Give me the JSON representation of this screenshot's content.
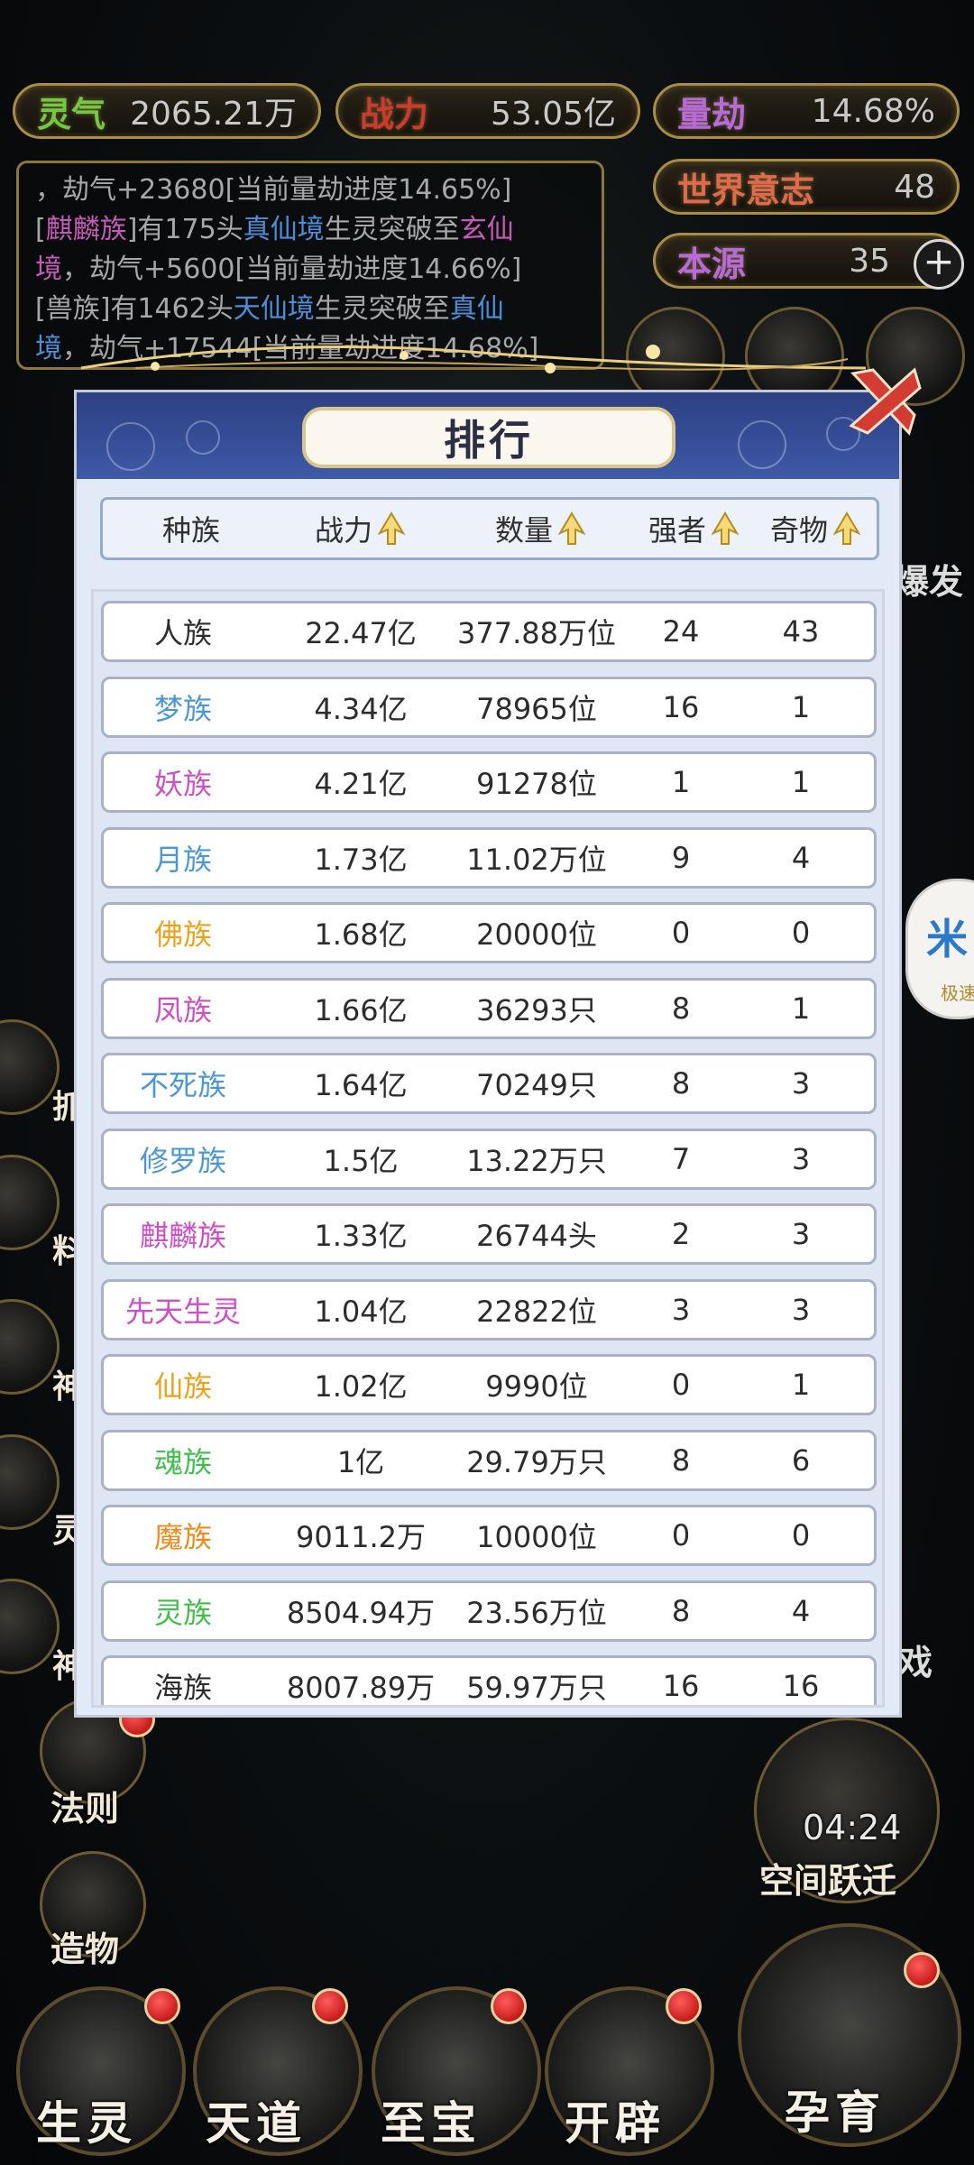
{
  "stats": {
    "lingqi": {
      "label": "灵气",
      "value": "2065.21万",
      "color": "#70c940"
    },
    "zhanli": {
      "label": "战力",
      "value": "53.05亿",
      "color": "#d13a2b"
    },
    "liangjie": {
      "label": "量劫",
      "value": "14.68%",
      "color": "#b86ad8"
    },
    "shijie": {
      "label": "世界意志",
      "value": "48",
      "color": "#e06a4a"
    },
    "benyuan": {
      "label": "本源",
      "value": "35",
      "color": "#b86ad8"
    }
  },
  "log": {
    "line1": "，劫气+23680[当前量劫进度14.65%]",
    "l2_a": "[",
    "l2_race": "麒麟族",
    "l2_b": "]有175头",
    "l2_realm": "真仙境",
    "l2_c": "生灵突破至",
    "l2_realm2": "玄仙",
    "l3_realm2b": "境",
    "l3_c": "，劫气+5600[当前量劫进度14.66%]",
    "l4_a": "[兽族]有1462头",
    "l4_realm": "天仙境",
    "l4_b": "生灵突破至",
    "l4_realm2": "真仙",
    "l5_realm2b": "境",
    "l5_c": "，劫气+17544[当前量劫进度14.68%]"
  },
  "panel": {
    "title": "排行",
    "headers": [
      "种族",
      "战力",
      "数量",
      "强者",
      "奇物"
    ],
    "rows": [
      {
        "name": "人族",
        "color": "#2c2c2c",
        "power": "22.47亿",
        "count": "377.88万位",
        "strong": "24",
        "items": "43"
      },
      {
        "name": "梦族",
        "color": "#4b97d6",
        "power": "4.34亿",
        "count": "78965位",
        "strong": "16",
        "items": "1"
      },
      {
        "name": "妖族",
        "color": "#cc4fc6",
        "power": "4.21亿",
        "count": "91278位",
        "strong": "1",
        "items": "1"
      },
      {
        "name": "月族",
        "color": "#4b97d6",
        "power": "1.73亿",
        "count": "11.02万位",
        "strong": "9",
        "items": "4"
      },
      {
        "name": "佛族",
        "color": "#eaa21b",
        "power": "1.68亿",
        "count": "20000位",
        "strong": "0",
        "items": "0"
      },
      {
        "name": "凤族",
        "color": "#cc4fc6",
        "power": "1.66亿",
        "count": "36293只",
        "strong": "8",
        "items": "1"
      },
      {
        "name": "不死族",
        "color": "#4b97d6",
        "power": "1.64亿",
        "count": "70249只",
        "strong": "8",
        "items": "3"
      },
      {
        "name": "修罗族",
        "color": "#4b97d6",
        "power": "1.5亿",
        "count": "13.22万只",
        "strong": "7",
        "items": "3"
      },
      {
        "name": "麒麟族",
        "color": "#cc4fc6",
        "power": "1.33亿",
        "count": "26744头",
        "strong": "2",
        "items": "3"
      },
      {
        "name": "先天生灵",
        "color": "#cc4fc6",
        "power": "1.04亿",
        "count": "22822位",
        "strong": "3",
        "items": "3"
      },
      {
        "name": "仙族",
        "color": "#eaa21b",
        "power": "1.02亿",
        "count": "9990位",
        "strong": "0",
        "items": "1"
      },
      {
        "name": "魂族",
        "color": "#3fbf4a",
        "power": "1亿",
        "count": "29.79万只",
        "strong": "8",
        "items": "6"
      },
      {
        "name": "魔族",
        "color": "#f08a1a",
        "power": "9011.2万",
        "count": "10000位",
        "strong": "0",
        "items": "0"
      },
      {
        "name": "灵族",
        "color": "#3fbf4a",
        "power": "8504.94万",
        "count": "23.56万位",
        "strong": "8",
        "items": "4"
      },
      {
        "name": "海族",
        "color": "#2c2c2c",
        "power": "8007.89万",
        "count": "59.97万只",
        "strong": "16",
        "items": "16"
      }
    ]
  },
  "side": {
    "left1": "法则",
    "left2": "造物",
    "right_time": "04:24",
    "right_label": "空间跃迁",
    "right_partial1": "爆发",
    "right_partial2": "戏",
    "left_partial": [
      "抓",
      "料",
      "神",
      "灵",
      "神"
    ],
    "floating": "米",
    "floating_sub": "极速"
  },
  "bottom": [
    "生灵",
    "天道",
    "至宝",
    "开辟",
    "孕育"
  ]
}
